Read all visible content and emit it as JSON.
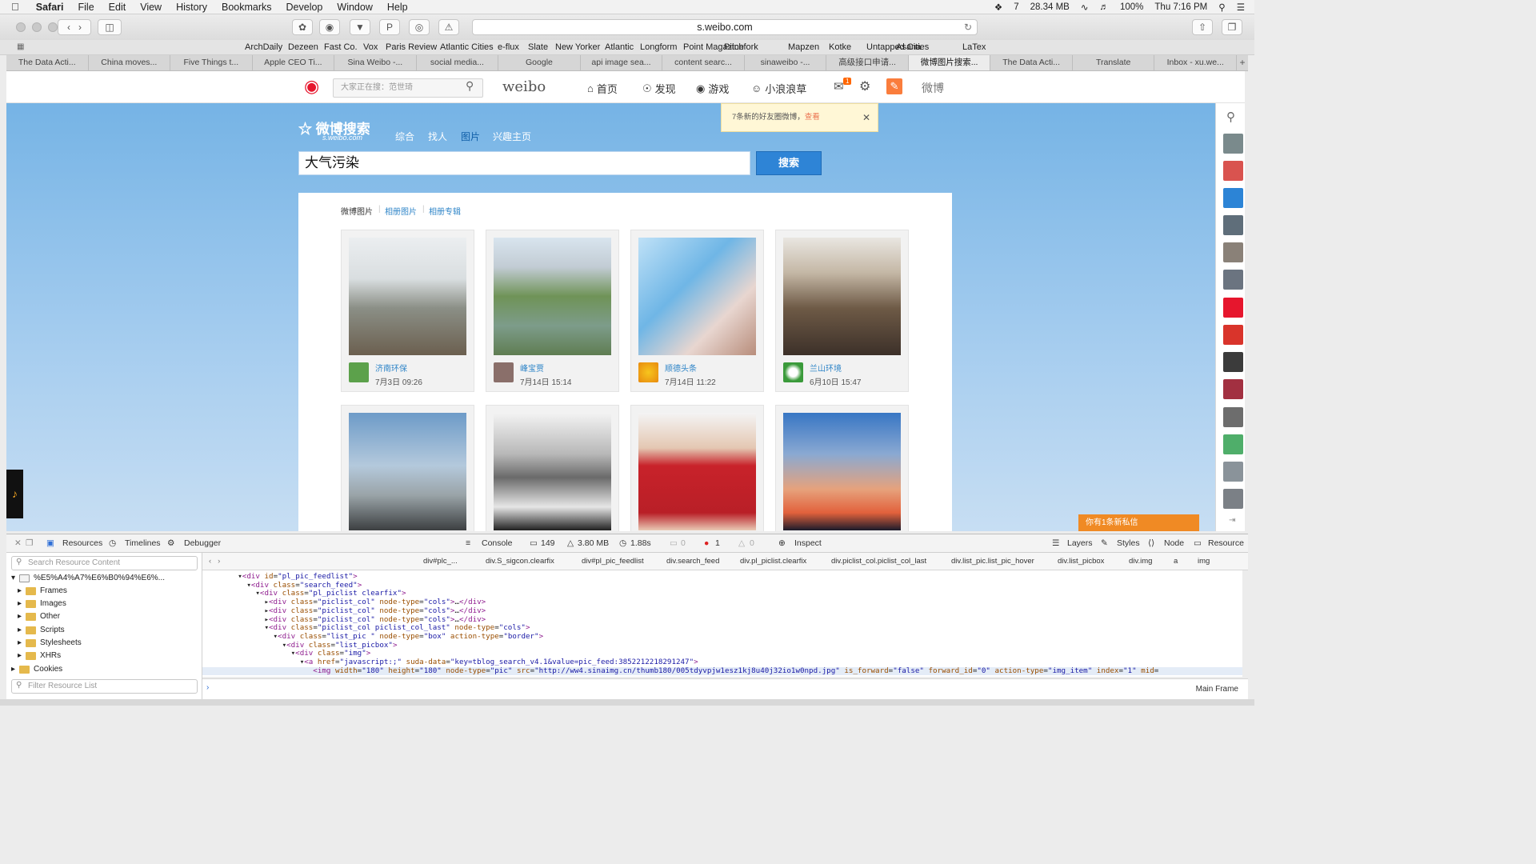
{
  "menubar": {
    "app": "Safari",
    "items": [
      "File",
      "Edit",
      "View",
      "History",
      "Bookmarks",
      "Develop",
      "Window",
      "Help"
    ],
    "status": {
      "memory": "28.34 MB",
      "badge": "7",
      "battery": "100%",
      "clock": "Thu 7:16 PM"
    }
  },
  "toolbar": {
    "url": "s.weibo.com"
  },
  "bookmarks": [
    "ArchDaily",
    "Dezeen",
    "Fast Co.",
    "Vox",
    "Paris Review",
    "Atlantic Cities",
    "e-flux",
    "Slate",
    "New Yorker",
    "Atlantic",
    "Longform",
    "Point Magazine",
    "Pitchfork",
    "Mapzen",
    "Kotke",
    "Untapped Cities",
    "Asana",
    "LaTex"
  ],
  "tabs": [
    "The Data Acti...",
    "China moves...",
    "Five Things t...",
    "Apple CEO Ti...",
    "Sina Weibo -...",
    "social media...",
    "Google",
    "api image sea...",
    "content searc...",
    "sinaweibo -...",
    "高级接口申请...",
    "微博图片搜索...",
    "The Data Acti...",
    "Translate",
    "Inbox - xu.we..."
  ],
  "active_tab": 11,
  "weibo": {
    "search_placeholder": "大家正在搜：范世琦",
    "logo": "weibo",
    "nav": [
      "首页",
      "发现",
      "游戏",
      "小浪浪草"
    ],
    "mail_badge": "1",
    "brand": "微博",
    "notice_text": "7条新的好友圈微博，",
    "notice_link": "查看",
    "search_logo": "微博搜索",
    "search_logo_sub": "s.weibo.com",
    "search_tabs": [
      "综合",
      "找人",
      "图片",
      "兴趣主页"
    ],
    "query": "大气污染",
    "search_button": "搜索",
    "sub_tabs": [
      "微博图片",
      "相册图片",
      "相册专辑"
    ],
    "results": [
      {
        "user": "济南环保",
        "time": "7月3日 09:26"
      },
      {
        "user": "峰宝贾",
        "time": "7月14日 15:14"
      },
      {
        "user": "顺德头条",
        "time": "7月14日 11:22"
      },
      {
        "user": "兰山环境",
        "time": "6月10日 15:47"
      }
    ],
    "private_msg": "你有1条新私信"
  },
  "inspector": {
    "tabs": [
      "Resources",
      "Timelines",
      "Debugger"
    ],
    "console": "Console",
    "counts": {
      "requests": "149",
      "size": "3.80 MB",
      "time": "1.88s",
      "logs": "0",
      "errors": "1",
      "warnings": "0"
    },
    "inspect": "Inspect",
    "right_tabs": [
      "Layers",
      "Styles",
      "Node",
      "Resource"
    ],
    "search_placeholder": "Search Resource Content",
    "root": "%E5%A4%A7%E6%B0%94%E6%...",
    "folders": [
      "Frames",
      "Images",
      "Other",
      "Scripts",
      "Stylesheets",
      "XHRs",
      "Cookies"
    ],
    "filter_placeholder": "Filter Resource List",
    "breadcrumbs": [
      "div#plc_...",
      "div.S_sigcon.clearfix",
      "div#pl_pic_feedlist",
      "div.search_feed",
      "div.pl_piclist.clearfix",
      "div.piclist_col.piclist_col_last",
      "div.list_pic.list_pic_hover",
      "div.list_picbox",
      "div.img",
      "a",
      "img"
    ],
    "frame": "Main Frame"
  }
}
